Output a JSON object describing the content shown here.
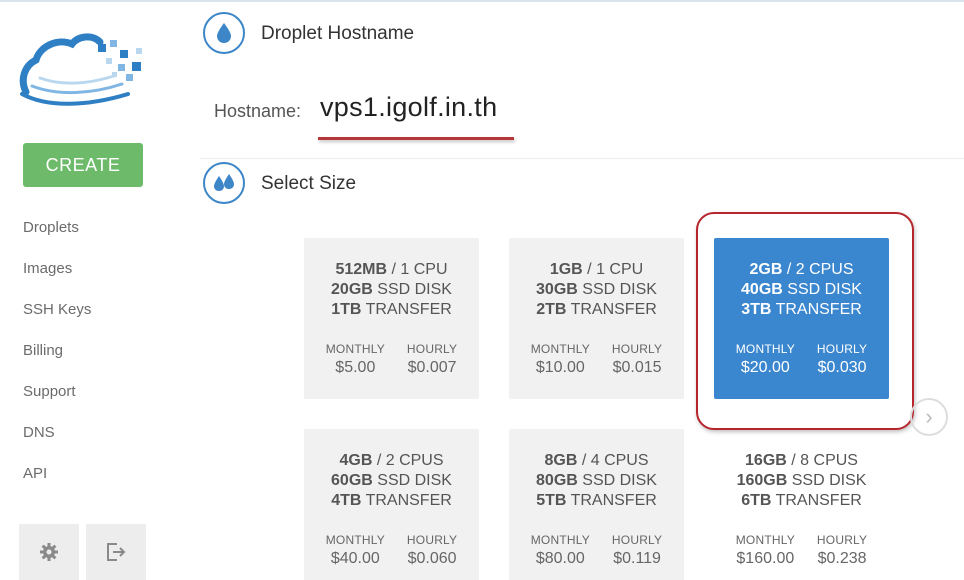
{
  "sidebar": {
    "create_label": "CREATE",
    "items": [
      {
        "label": "Droplets"
      },
      {
        "label": "Images"
      },
      {
        "label": "SSH Keys"
      },
      {
        "label": "Billing"
      },
      {
        "label": "Support"
      },
      {
        "label": "DNS"
      },
      {
        "label": "API"
      }
    ],
    "bottom_icons": [
      "gear-icon",
      "logout-icon"
    ]
  },
  "hostname_section": {
    "title": "Droplet Hostname",
    "label": "Hostname:",
    "value": "vps1.igolf.in.th"
  },
  "size_section": {
    "title": "Select Size",
    "monthly_label": "MONTHLY",
    "hourly_label": "HOURLY",
    "sizes": [
      {
        "mem": "512MB",
        "cpu": "1 CPU",
        "disk": "20GB",
        "disk_label": "SSD DISK",
        "transfer": "1TB",
        "transfer_label": "TRANSFER",
        "monthly": "$5.00",
        "hourly": "$0.007"
      },
      {
        "mem": "1GB",
        "cpu": "1 CPU",
        "disk": "30GB",
        "disk_label": "SSD DISK",
        "transfer": "2TB",
        "transfer_label": "TRANSFER",
        "monthly": "$10.00",
        "hourly": "$0.015"
      },
      {
        "mem": "2GB",
        "cpu": "2 CPUS",
        "disk": "40GB",
        "disk_label": "SSD DISK",
        "transfer": "3TB",
        "transfer_label": "TRANSFER",
        "monthly": "$20.00",
        "hourly": "$0.030",
        "selected": true
      },
      {
        "mem": "4GB",
        "cpu": "2 CPUS",
        "disk": "60GB",
        "disk_label": "SSD DISK",
        "transfer": "4TB",
        "transfer_label": "TRANSFER",
        "monthly": "$40.00",
        "hourly": "$0.060"
      },
      {
        "mem": "8GB",
        "cpu": "4 CPUS",
        "disk": "80GB",
        "disk_label": "SSD DISK",
        "transfer": "5TB",
        "transfer_label": "TRANSFER",
        "monthly": "$80.00",
        "hourly": "$0.119"
      },
      {
        "mem": "16GB",
        "cpu": "8 CPUS",
        "disk": "160GB",
        "disk_label": "SSD DISK",
        "transfer": "6TB",
        "transfer_label": "TRANSFER",
        "monthly": "$160.00",
        "hourly": "$0.238"
      }
    ],
    "next_arrow": "›"
  },
  "colors": {
    "accent": "#3b87cf",
    "create_button": "#6dbb6a",
    "annotation_red": "#b5373a"
  }
}
